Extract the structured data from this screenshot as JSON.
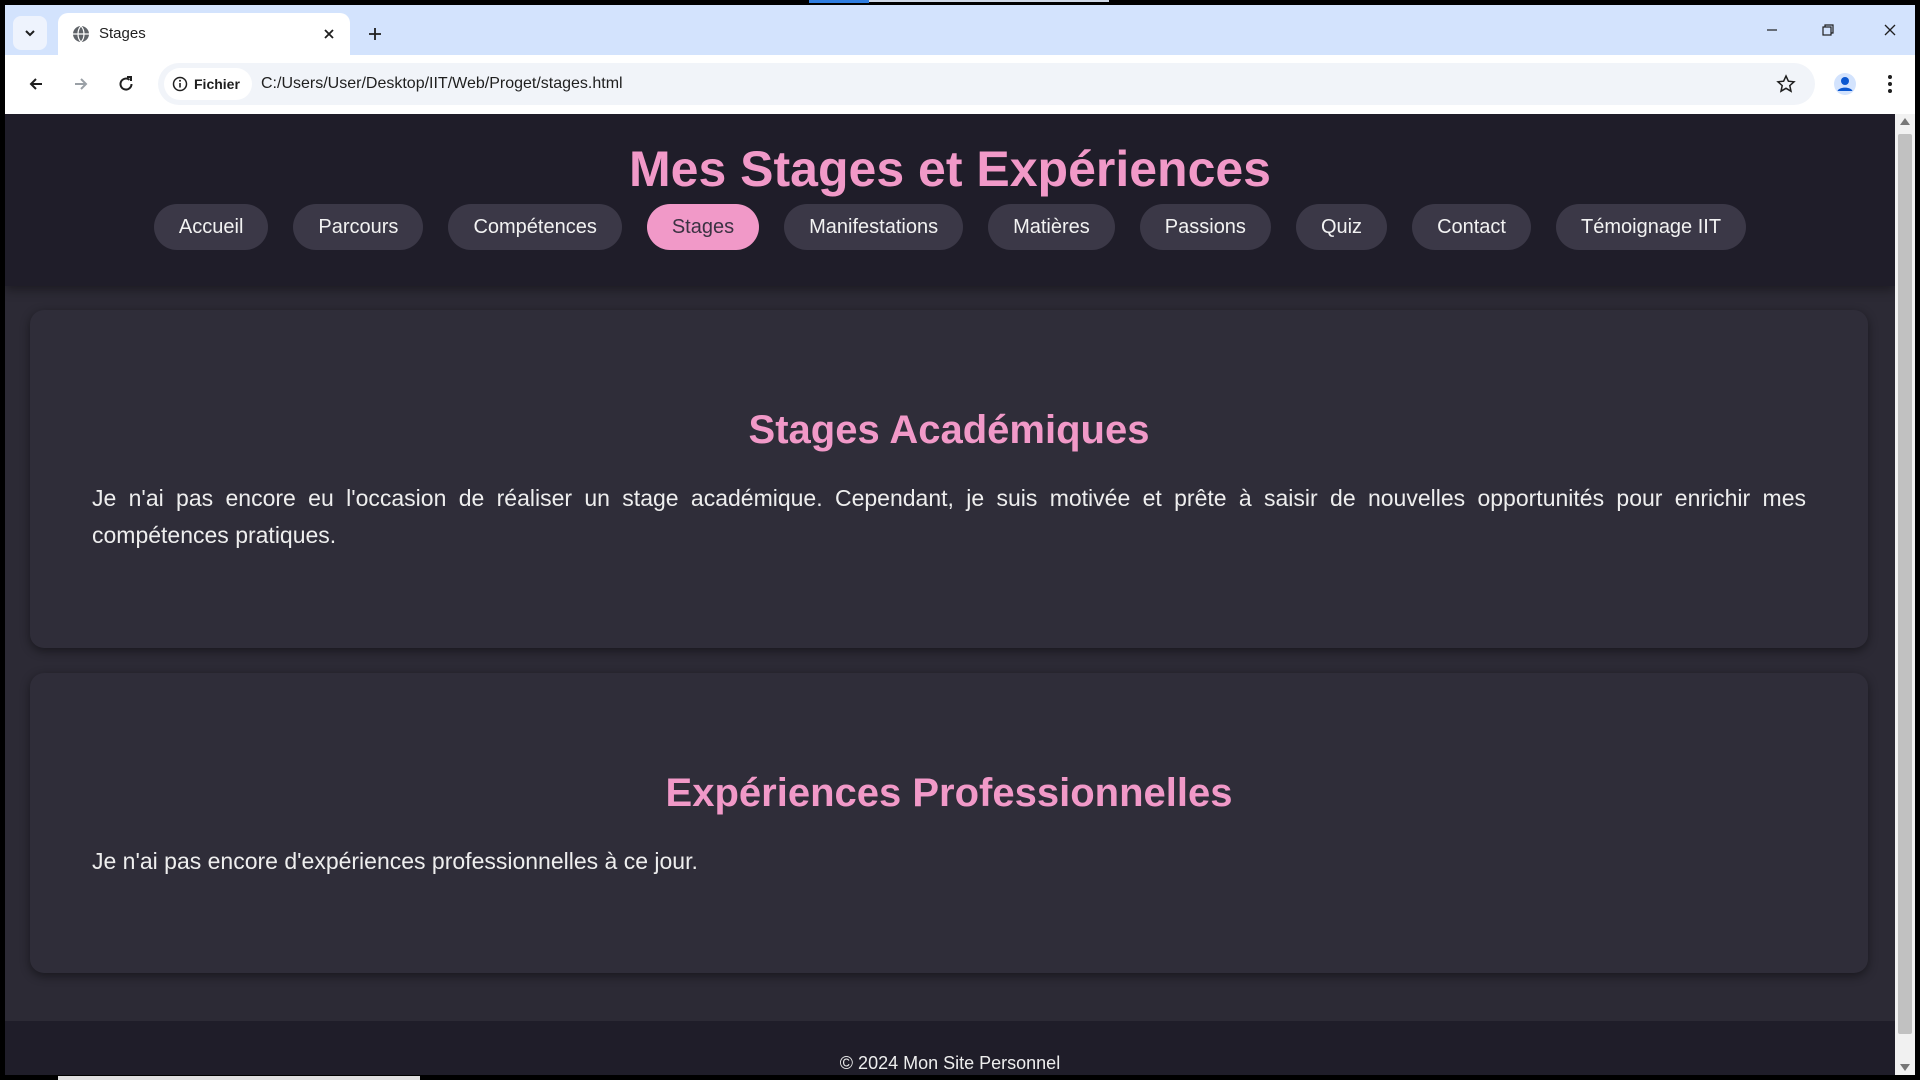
{
  "browser": {
    "tab_title": "Stages",
    "site_chip_label": "Fichier",
    "url": "C:/Users/User/Desktop/IIT/Web/Proget/stages.html",
    "icons": [
      "chevron-down-icon",
      "globe-icon",
      "close-icon",
      "plus-icon",
      "minimize-icon",
      "restore-icon",
      "back-arrow-icon",
      "forward-arrow-icon",
      "reload-icon",
      "info-icon",
      "star-icon",
      "profile-icon",
      "kebab-menu-icon"
    ]
  },
  "site": {
    "title": "Mes Stages et Expériences",
    "nav": [
      {
        "label": "Accueil",
        "active": false
      },
      {
        "label": "Parcours",
        "active": false
      },
      {
        "label": "Compétences",
        "active": false
      },
      {
        "label": "Stages",
        "active": true
      },
      {
        "label": "Manifestations",
        "active": false
      },
      {
        "label": "Matières",
        "active": false
      },
      {
        "label": "Passions",
        "active": false
      },
      {
        "label": "Quiz",
        "active": false
      },
      {
        "label": "Contact",
        "active": false
      },
      {
        "label": "Témoignage IIT",
        "active": false
      }
    ],
    "sections": [
      {
        "heading": "Stages Académiques",
        "text": "Je n'ai pas encore eu l'occasion de réaliser un stage académique. Cependant, je suis motivée et prête à saisir de nouvelles opportunités pour enrichir mes compétences pratiques."
      },
      {
        "heading": "Expériences Professionnelles",
        "text": "Je n'ai pas encore d'expériences professionnelles à ce jour."
      }
    ],
    "footer": "© 2024 Mon Site Personnel"
  },
  "colors": {
    "accent_pink": "#f199c8",
    "header_bg": "#1f1d29",
    "page_bg": "#2c2a35",
    "card_bg": "#2f2d39",
    "pill_bg": "#3b3847"
  }
}
